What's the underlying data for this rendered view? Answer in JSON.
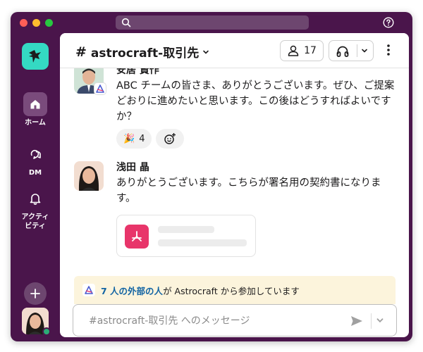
{
  "colors": {
    "sidebar": "#4a154b",
    "workspace_logo": "#34d9c3",
    "link": "#1264a3",
    "banner": "#fcf4dc",
    "pdf": "#e8356a",
    "presence": "#2bac76"
  },
  "search": {
    "placeholder": ""
  },
  "rail": {
    "items": [
      {
        "label": "ホーム",
        "icon": "home-icon",
        "active": true
      },
      {
        "label": "DM",
        "icon": "dm-icon",
        "active": false
      },
      {
        "label": "アクティ\nビティ",
        "icon": "bell-icon",
        "active": false
      }
    ]
  },
  "channel": {
    "hash": "#",
    "name": "astrocraft-取引先",
    "member_count": "17"
  },
  "messages": [
    {
      "author": "安居 賢作",
      "text": "ABC チームの皆さま、ありがとうございます。ぜひ、ご提案どおりに進めたいと思います。この後はどうすればよいですか？",
      "reactions": [
        {
          "emoji": "🎉",
          "count": "4"
        }
      ]
    },
    {
      "author": "浅田 晶",
      "text": "ありがとうございます。こちらが署名用の契約書になります。",
      "attachment": {
        "type": "pdf-icon"
      }
    }
  ],
  "banner": {
    "link_text": "7 人の外部の人",
    "rest_text": "が Astrocraft から参加しています"
  },
  "composer": {
    "placeholder": "#astrocraft-取引先 へのメッセージ"
  }
}
